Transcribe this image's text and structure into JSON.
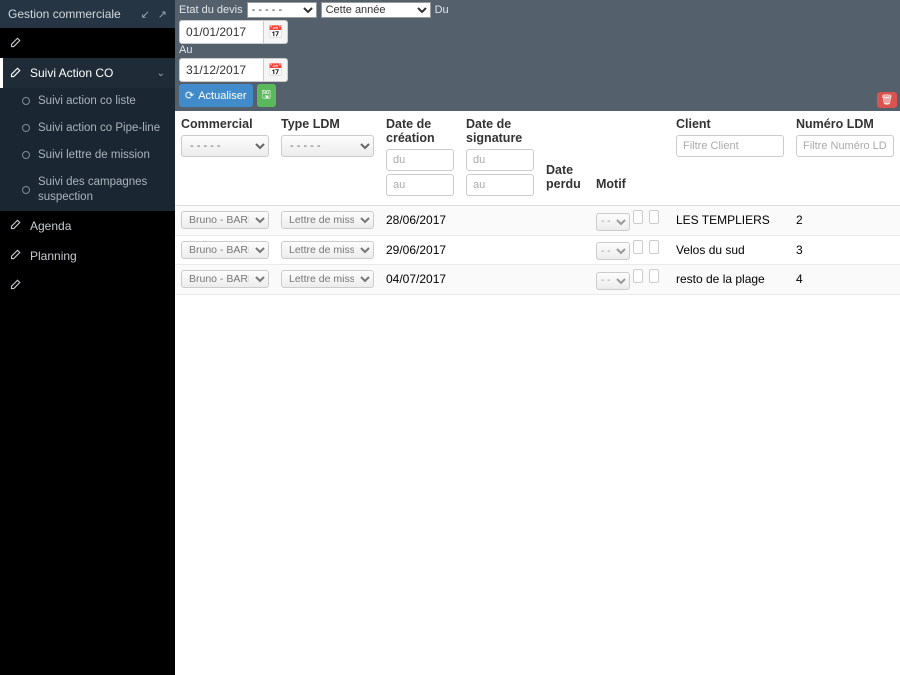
{
  "sidebar": {
    "title": "Gestion commerciale",
    "items": [
      {
        "label": ""
      },
      {
        "label": "Suivi Action CO"
      },
      {
        "label": "Agenda"
      },
      {
        "label": "Planning"
      },
      {
        "label": ""
      }
    ],
    "sub": [
      {
        "label": "Suivi action co liste"
      },
      {
        "label": "Suivi action co Pipe-line"
      },
      {
        "label": "Suivi lettre de mission"
      },
      {
        "label": "Suivi des campagnes suspection"
      }
    ]
  },
  "topbar": {
    "etat_label": "Etat du devis",
    "etat_value": "- - - - -",
    "periode_value": "Cette année",
    "du_label": "Du",
    "du_value": "01/01/2017",
    "au_label": "Au",
    "au_value": "31/12/2017",
    "refresh_label": "Actualiser"
  },
  "columns": {
    "commercial": "Commercial",
    "type_ldm": "Type LDM",
    "date_creation": "Date de création",
    "date_signature": "Date de signature",
    "date_perdu": "Date perdu",
    "motif": "Motif",
    "client": "Client",
    "numero_ldm": "Numéro LDM",
    "select_placeholder": "- - - - -",
    "du_placeholder": "du",
    "au_placeholder": "au",
    "motif_placeholder": "- - -",
    "client_filter_placeholder": "Filtre Client",
    "numero_filter_placeholder": "Filtre Numéro LDM"
  },
  "rows": [
    {
      "commercial": "Bruno - BARBERA",
      "type": "Lettre de mission BN",
      "date_creation": "28/06/2017",
      "date_signature": "",
      "client": "LES TEMPLIERS",
      "numero": "2"
    },
    {
      "commercial": "Bruno - BARBERA",
      "type": "Lettre de mission BN",
      "date_creation": "29/06/2017",
      "date_signature": "",
      "client": "Velos du sud",
      "numero": "3"
    },
    {
      "commercial": "Bruno - BARBERA",
      "type": "Lettre de mission BN",
      "date_creation": "04/07/2017",
      "date_signature": "",
      "client": "resto de la plage",
      "numero": "4"
    }
  ]
}
